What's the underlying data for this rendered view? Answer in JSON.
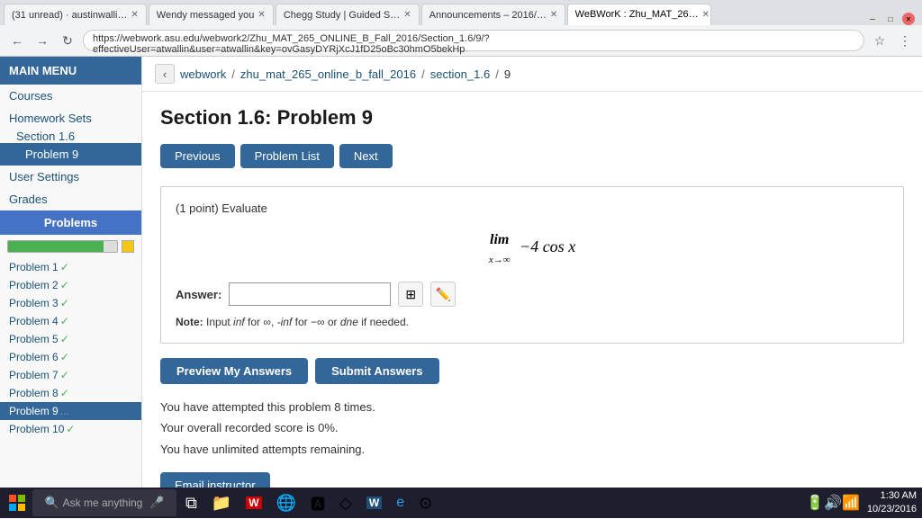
{
  "browser": {
    "tabs": [
      {
        "label": "(31 unread) · austinwalli…",
        "active": false
      },
      {
        "label": "Wendy messaged you",
        "active": false
      },
      {
        "label": "Chegg Study | Guided S…",
        "active": false
      },
      {
        "label": "Announcements – 2016/…",
        "active": false
      },
      {
        "label": "WeBWorK : Zhu_MAT_26…",
        "active": true
      }
    ],
    "url": "https://webwork.asu.edu/webwork2/Zhu_MAT_265_ONLINE_B_Fall_2016/Section_1.6/9/?effectiveUser=atwallin&user=atwallin&key=ovGasyDYRjXcJ1fD25oBc30hmO5bekHp"
  },
  "sidebar": {
    "header": "MAIN MENU",
    "courses_label": "Courses",
    "homework_sets_label": "Homework Sets",
    "section_label": "Section 1.6",
    "active_problem_label": "Problem 9",
    "user_settings_label": "User Settings",
    "grades_label": "Grades",
    "problems_header": "Problems",
    "problems": [
      {
        "label": "Problem 1",
        "check": "✓",
        "active": false
      },
      {
        "label": "Problem 2",
        "check": "✓",
        "active": false
      },
      {
        "label": "Problem 3",
        "check": "✓",
        "active": false
      },
      {
        "label": "Problem 4",
        "check": "✓",
        "active": false
      },
      {
        "label": "Problem 5",
        "check": "✓",
        "active": false
      },
      {
        "label": "Problem 6",
        "check": "✓",
        "active": false
      },
      {
        "label": "Problem 7",
        "check": "✓",
        "active": false
      },
      {
        "label": "Problem 8",
        "check": "✓",
        "active": false
      },
      {
        "label": "Problem 9",
        "check": "…",
        "active": true
      },
      {
        "label": "Problem 10",
        "check": "✓",
        "active": false
      }
    ],
    "progress_pct": 88
  },
  "breadcrumb": {
    "back_label": "‹",
    "webwork": "webwork",
    "course": "zhu_mat_265_online_b_fall_2016",
    "section": "section_1.6",
    "problem": "9"
  },
  "main": {
    "title": "Section 1.6: Problem 9",
    "buttons": {
      "previous": "Previous",
      "problem_list": "Problem List",
      "next": "Next"
    },
    "problem_text": "(1 point) Evaluate",
    "math_display": "lim −4 cos x",
    "math_limit": "lim",
    "math_subscript": "x→∞",
    "math_expr": "−4 cos x",
    "answer_label": "Answer:",
    "answer_value": "",
    "answer_placeholder": "",
    "grid_icon": "⊞",
    "pencil_icon": "✏",
    "note_label": "Note:",
    "note_text": "Input inf for ∞, -inf for −∞ or dne if needed.",
    "note_inf": "inf",
    "note_neg_inf": "-inf",
    "note_dne": "dne",
    "preview_button": "Preview My Answers",
    "submit_button": "Submit Answers",
    "attempt_line1": "You have attempted this problem 8 times.",
    "attempt_line2": "Your overall recorded score is 0%.",
    "attempt_line3": "You have unlimited attempts remaining.",
    "email_button": "Email instructor"
  },
  "taskbar": {
    "time": "1:30 AM",
    "date": "10/23/2016",
    "search_placeholder": "Ask me anything"
  }
}
